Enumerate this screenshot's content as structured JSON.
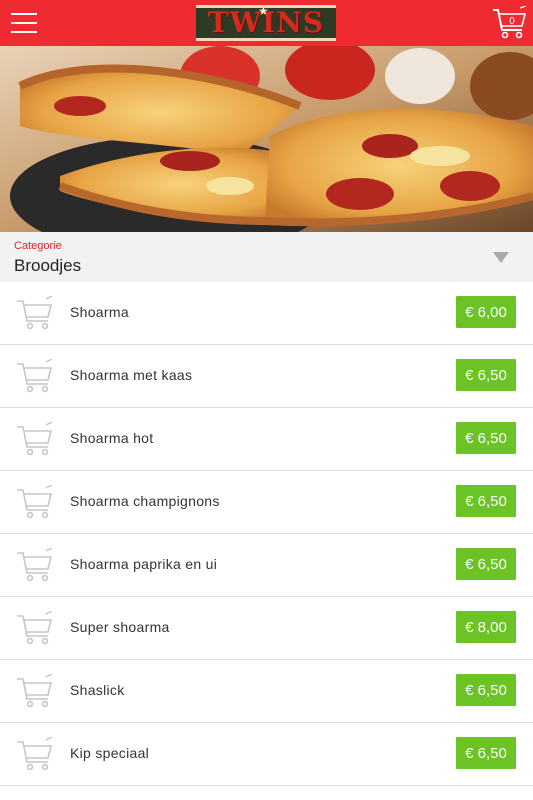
{
  "header": {
    "menu_icon": "hamburger-menu-icon",
    "logo_text": "TWINS",
    "cart_icon": "shopping-cart-icon",
    "cart_count": "0",
    "brand_color": "#ef2a31"
  },
  "hero": {
    "image": "pizza-photo"
  },
  "category": {
    "label": "Categorie",
    "value": "Broodjes",
    "dropdown_icon": "triangle-down-icon"
  },
  "products": [
    {
      "name": "Shoarma",
      "price": "€ 6,00"
    },
    {
      "name": "Shoarma met kaas",
      "price": "€ 6,50"
    },
    {
      "name": "Shoarma hot",
      "price": "€ 6,50"
    },
    {
      "name": "Shoarma champignons",
      "price": "€ 6,50"
    },
    {
      "name": "Shoarma paprika en ui",
      "price": "€ 6,50"
    },
    {
      "name": "Super shoarma",
      "price": "€ 8,00"
    },
    {
      "name": "Shaslick",
      "price": "€ 6,50"
    },
    {
      "name": "Kip speciaal",
      "price": "€ 6,50"
    }
  ],
  "colors": {
    "price_badge": "#6cc326",
    "category_label": "#e0262e"
  }
}
